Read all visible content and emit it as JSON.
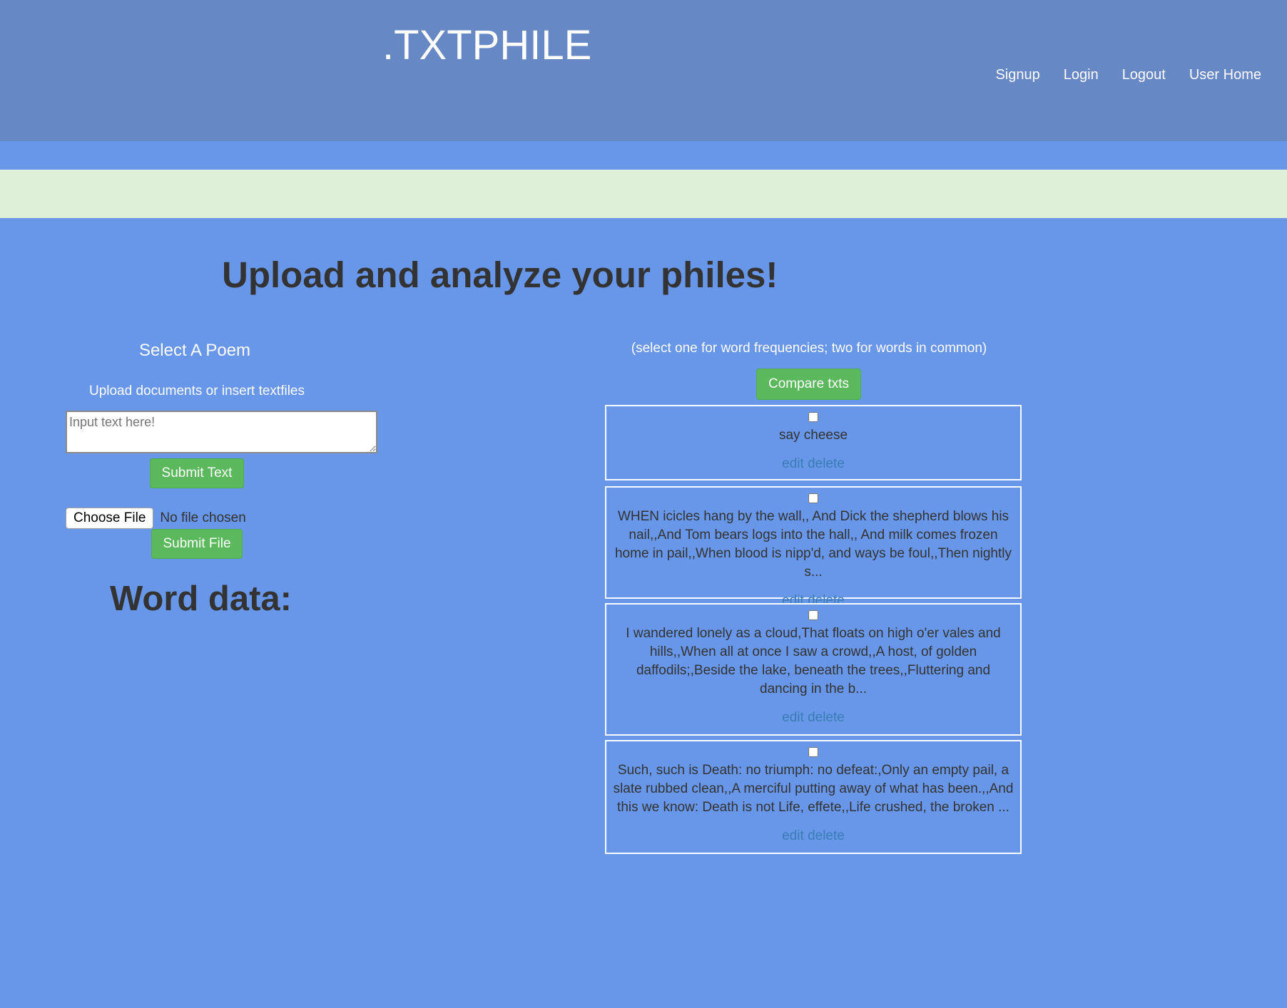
{
  "header": {
    "brand": ".TXTPHILE",
    "nav": [
      {
        "label": "Signup"
      },
      {
        "label": "Login"
      },
      {
        "label": "Logout"
      },
      {
        "label": "User Home"
      }
    ]
  },
  "flash": {
    "message": ""
  },
  "main": {
    "heading": "Upload and analyze your philes!"
  },
  "left": {
    "section_title": "Select A Poem",
    "upload_label": "Upload documents or insert textfiles",
    "text_input": {
      "placeholder": "Input text here!",
      "value": ""
    },
    "submit_text_label": "Submit Text",
    "choose_file_label": "Choose File",
    "file_status": "No file chosen",
    "submit_file_label": "Submit File",
    "word_data_heading": "Word data:"
  },
  "right": {
    "hint": "(select one for word frequencies; two for words in common)",
    "compare_label": "Compare txts",
    "txts": [
      {
        "text": "say cheese",
        "edit": "edit",
        "delete": "delete"
      },
      {
        "text": "WHEN icicles hang by the wall,, And Dick the shepherd blows his nail,,And Tom bears logs into the hall,, And milk comes frozen home in pail,,When blood is nipp'd, and ways be foul,,Then nightly s...",
        "edit": "edit",
        "delete": "delete"
      },
      {
        "text": "I wandered lonely as a cloud,That floats on high o'er vales and hills,,When all at once I saw a crowd,,A host, of golden daffodils;,Beside the lake, beneath the trees,,Fluttering and dancing in the b...",
        "edit": "edit",
        "delete": "delete"
      },
      {
        "text": "Such, such is Death: no triumph: no defeat:,Only an empty pail, a slate rubbed clean,,A merciful putting away of what has been.,,And this we know: Death is not Life, effete,,Life crushed, the broken ...",
        "edit": "edit",
        "delete": "delete"
      }
    ]
  },
  "colors": {
    "page_bg": "#6897e9",
    "header_bg": "#6688c4",
    "flash_bg": "#dff0d8",
    "button_green": "#5cb85c",
    "link_blue": "#3a7db5"
  }
}
